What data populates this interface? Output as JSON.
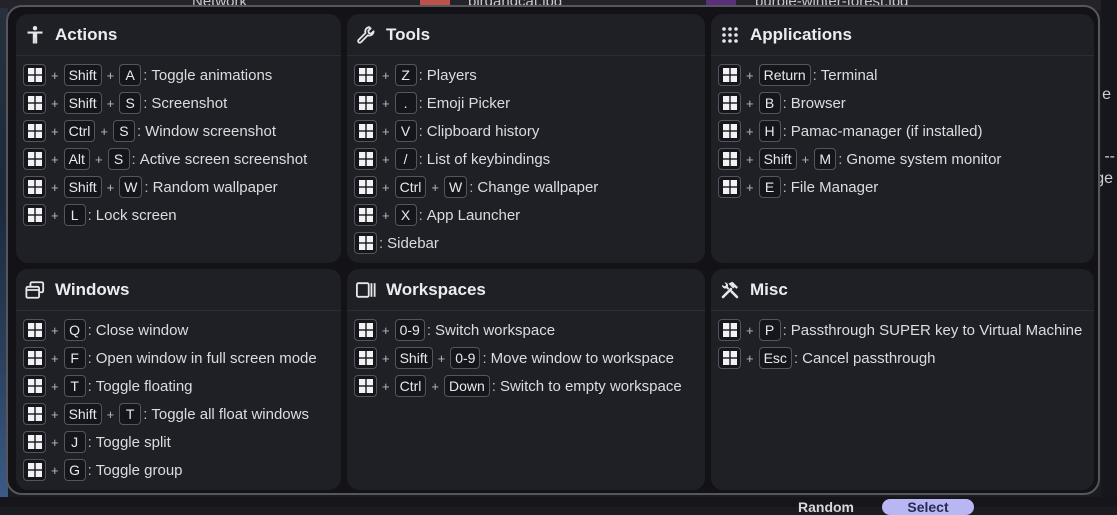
{
  "background": {
    "label_network": "Network",
    "file_1": "birdandcat.jpg",
    "file_2": "purple-winter-forest.jpg",
    "button_random": "Random",
    "button_select": "Select"
  },
  "panels": [
    {
      "title": "Actions",
      "icon": "accessibility-icon",
      "rows": [
        {
          "keys": [
            "Shift",
            "A"
          ],
          "desc": "Toggle animations"
        },
        {
          "keys": [
            "Shift",
            "S"
          ],
          "desc": "Screenshot"
        },
        {
          "keys": [
            "Ctrl",
            "S"
          ],
          "desc": "Window screenshot"
        },
        {
          "keys": [
            "Alt",
            "S"
          ],
          "desc": "Active screen screenshot"
        },
        {
          "keys": [
            "Shift",
            "W"
          ],
          "desc": "Random wallpaper"
        },
        {
          "keys": [
            "L"
          ],
          "desc": "Lock screen"
        }
      ]
    },
    {
      "title": "Tools",
      "icon": "wrench-icon",
      "rows": [
        {
          "keys": [
            "Z"
          ],
          "desc": "Players"
        },
        {
          "keys": [
            "."
          ],
          "desc": "Emoji Picker"
        },
        {
          "keys": [
            "V"
          ],
          "desc": "Clipboard history"
        },
        {
          "keys": [
            "/"
          ],
          "desc": "List of keybindings"
        },
        {
          "keys": [
            "Ctrl",
            "W"
          ],
          "desc": "Change wallpaper"
        },
        {
          "keys": [
            "X"
          ],
          "desc": "App Launcher"
        },
        {
          "keys": [],
          "desc": "Sidebar"
        }
      ]
    },
    {
      "title": "Applications",
      "icon": "apps-grid-icon",
      "rows": [
        {
          "keys": [
            "Return"
          ],
          "desc": "Terminal"
        },
        {
          "keys": [
            "B"
          ],
          "desc": "Browser"
        },
        {
          "keys": [
            "H"
          ],
          "desc": "Pamac-manager (if installed)"
        },
        {
          "keys": [
            "Shift",
            "M"
          ],
          "desc": "Gnome system monitor"
        },
        {
          "keys": [
            "E"
          ],
          "desc": "File Manager"
        }
      ]
    },
    {
      "title": "Windows",
      "icon": "windows-stack-icon",
      "rows": [
        {
          "keys": [
            "Q"
          ],
          "desc": "Close window"
        },
        {
          "keys": [
            "F"
          ],
          "desc": "Open window in full screen mode"
        },
        {
          "keys": [
            "T"
          ],
          "desc": "Toggle floating"
        },
        {
          "keys": [
            "Shift",
            "T"
          ],
          "desc": "Toggle all float windows"
        },
        {
          "keys": [
            "J"
          ],
          "desc": "Toggle split"
        },
        {
          "keys": [
            "G"
          ],
          "desc": "Toggle group"
        }
      ]
    },
    {
      "title": "Workspaces",
      "icon": "workspaces-icon",
      "rows": [
        {
          "keys": [
            "0-9"
          ],
          "desc": "Switch workspace"
        },
        {
          "keys": [
            "Shift",
            "0-9"
          ],
          "desc": "Move window to workspace"
        },
        {
          "keys": [
            "Ctrl",
            "Down"
          ],
          "desc": "Switch to empty workspace"
        }
      ]
    },
    {
      "title": "Misc",
      "icon": "tools-icon",
      "rows": [
        {
          "keys": [
            "P"
          ],
          "desc": "Passthrough SUPER key to Virtual Machine"
        },
        {
          "keys": [
            "Esc"
          ],
          "desc": "Cancel passthrough"
        }
      ]
    }
  ]
}
